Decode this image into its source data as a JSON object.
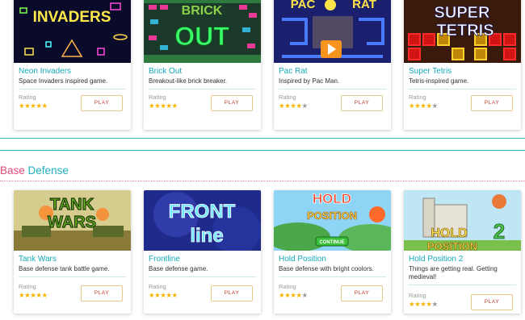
{
  "section": {
    "title_first": "Base",
    "title_second": "Defense"
  },
  "colors": {
    "accent_teal": "#16a9b8",
    "accent_pink": "#e04a77",
    "star_on": "#f5b400",
    "star_off": "#9b9b9b",
    "play_text": "#c0392b",
    "play_border": "#e7c784"
  },
  "rows": [
    {
      "cards": [
        {
          "title": "Neon Invaders",
          "desc": "Space Invaders inspired game.",
          "rating_label": "Rating",
          "stars": 5,
          "play": "PLAY",
          "thumb_text": "INVADERS"
        },
        {
          "title": "Brick Out",
          "desc": "Breakout-like brick breaker.",
          "rating_label": "Rating",
          "stars": 5,
          "play": "PLAY",
          "thumb_text": "OUT"
        },
        {
          "title": "Pac Rat",
          "desc": "Inspired by Pac Man.",
          "rating_label": "Rating",
          "stars": 4,
          "play": "PLAY",
          "thumb_text": "PAC RAT"
        },
        {
          "title": "Super Tetris",
          "desc": "Tetris-inspired game.",
          "rating_label": "Rating",
          "stars": 4,
          "play": "PLAY",
          "thumb_text_1": "SUPER",
          "thumb_text_2": "TETRIS"
        }
      ]
    },
    {
      "cards": [
        {
          "title": "Tank Wars",
          "desc": "Base defense tank battle game.",
          "rating_label": "Rating",
          "stars": 5,
          "play": "PLAY",
          "thumb_text_1": "TANK",
          "thumb_text_2": "WARS"
        },
        {
          "title": "Frontline",
          "desc": "Base defense game.",
          "rating_label": "Rating",
          "stars": 5,
          "play": "PLAY",
          "thumb_text_1": "FRONT",
          "thumb_text_2": "line"
        },
        {
          "title": "Hold Position",
          "desc": "Base defense with bright coolors.",
          "rating_label": "Rating",
          "stars": 4,
          "play": "PLAY",
          "thumb_text_1": "HOLD",
          "thumb_text_2": "POSITION",
          "thumb_button": "CONTINUE"
        },
        {
          "title": "Hold Position 2",
          "desc": "Things are getting real. Getting medieval!",
          "rating_label": "Rating",
          "stars": 4,
          "play": "PLAY",
          "thumb_text_1": "HOLD",
          "thumb_text_2": "POSITION",
          "thumb_text_3": "2"
        }
      ]
    }
  ]
}
